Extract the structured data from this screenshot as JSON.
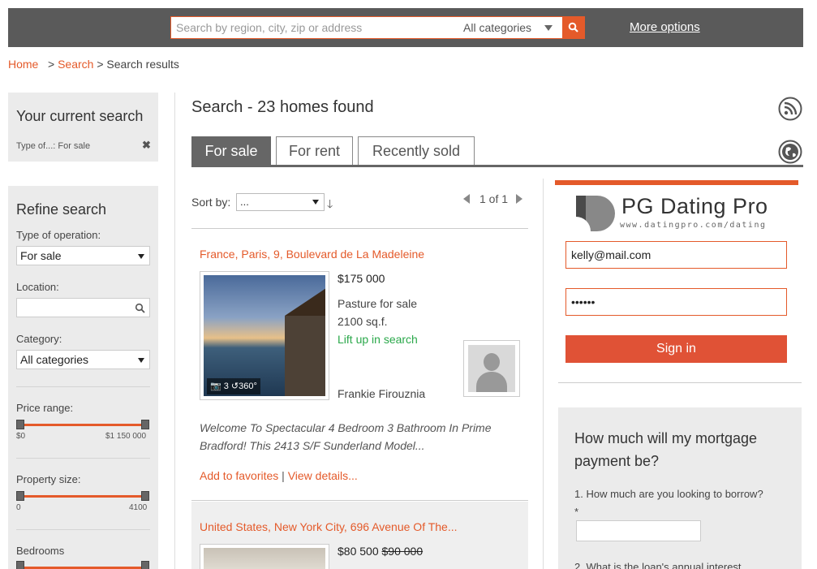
{
  "header": {
    "search_placeholder": "Search by region, city, zip or address",
    "category": "All categories",
    "more_options": "More options"
  },
  "breadcrumb": {
    "home": "Home",
    "search": "Search",
    "current": "Search results"
  },
  "current_search": {
    "title": "Your current search",
    "tag": "Type of...: For sale",
    "remove_symbol": "✖"
  },
  "refine": {
    "title": "Refine search",
    "operation_label": "Type of operation:",
    "operation_value": "For sale",
    "location_label": "Location:",
    "category_label": "Category:",
    "category_value": "All categories",
    "price_label": "Price range:",
    "price_min": "$0",
    "price_max": "$1 150 000",
    "size_label": "Property size:",
    "size_min": "0",
    "size_max": "4100",
    "bedrooms_label": "Bedrooms"
  },
  "main": {
    "title": "Search - 23 homes found",
    "tabs": [
      "For sale",
      "For rent",
      "Recently sold"
    ],
    "sort_label": "Sort by:",
    "sort_value": "...",
    "pager": "1 of 1"
  },
  "listings": [
    {
      "address": "France, Paris, 9, Boulevard de La Madeleine",
      "photo_badge": "📷 3  ↺360°",
      "price": "$175 000",
      "type": "Pasture for sale",
      "size": "2100 sq.f.",
      "lift": "Lift up in search",
      "agent": "Frankie Firouznia",
      "description": "Welcome To Spectacular 4 Bedroom 3 Bathroom In Prime Bradford! This 2413 S/F Sunderland Model...",
      "add_favorites": "Add to favorites",
      "view_details": "View details..."
    },
    {
      "address": "United States, New York City, 696 Avenue Of The...",
      "price": "$80 500",
      "old_price": "$90 000"
    }
  ],
  "login": {
    "brand": "PG Dating Pro",
    "brand_sub": "www.datingpro.com/dating",
    "email": "kelly@mail.com",
    "password": "••••••",
    "sign_in": "Sign in"
  },
  "mortgage": {
    "title": "How much will my mortgage payment be?",
    "q1": "1. How much are you looking to borrow? *",
    "q2": "2. What is the loan's annual interest"
  },
  "colors": {
    "accent": "#e45a2a",
    "topbar": "#5a5a5a",
    "panel": "#ebebeb",
    "green": "#2aa84a"
  }
}
